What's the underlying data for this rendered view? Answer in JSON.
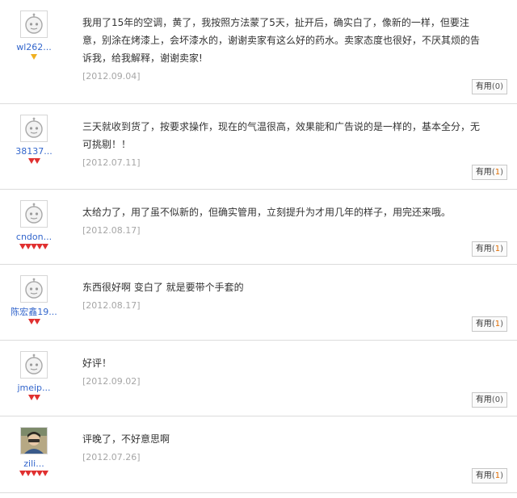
{
  "useful_label": "有用",
  "reviews": [
    {
      "username": "wl262...",
      "avatar": "robot-avatar",
      "level": {
        "count": 1,
        "type": "gold"
      },
      "content": "我用了15年的空调，黄了，我按照方法蒙了5天，扯开后，确实白了，像新的一样，但要注意，别涂在烤漆上，会坏漆水的，谢谢卖家有这么好的药水。卖家态度也很好，不厌其烦的告诉我，给我解释，谢谢卖家!",
      "date": "[2012.09.04]",
      "useful_count": "0"
    },
    {
      "username": "38137...",
      "avatar": "robot-avatar",
      "level": {
        "count": 2,
        "type": "red"
      },
      "content": "三天就收到货了，按要求操作，现在的气温很高，效果能和广告说的是一样的，基本全分，无可挑剔！！",
      "date": "[2012.07.11]",
      "useful_count": "1"
    },
    {
      "username": "cndon...",
      "avatar": "robot-avatar",
      "level": {
        "count": 5,
        "type": "red"
      },
      "content": "太给力了，用了虽不似新的，但确实管用，立刻提升为才用几年的样子，用完还来哦。",
      "date": "[2012.08.17]",
      "useful_count": "1"
    },
    {
      "username": "陈宏鑫19...",
      "avatar": "robot-avatar",
      "level": {
        "count": 2,
        "type": "red"
      },
      "content": "东西很好啊 变白了 就是要带个手套的",
      "date": "[2012.08.17]",
      "useful_count": "1"
    },
    {
      "username": "jmeip...",
      "avatar": "robot-avatar",
      "level": {
        "count": 2,
        "type": "red"
      },
      "content": "好评！",
      "date": "[2012.09.02]",
      "useful_count": "0"
    },
    {
      "username": "zili...",
      "avatar": "photo-avatar",
      "level": {
        "count": 5,
        "type": "red"
      },
      "content": "评晚了，不好意思啊",
      "date": "[2012.07.26]",
      "useful_count": "1"
    }
  ]
}
